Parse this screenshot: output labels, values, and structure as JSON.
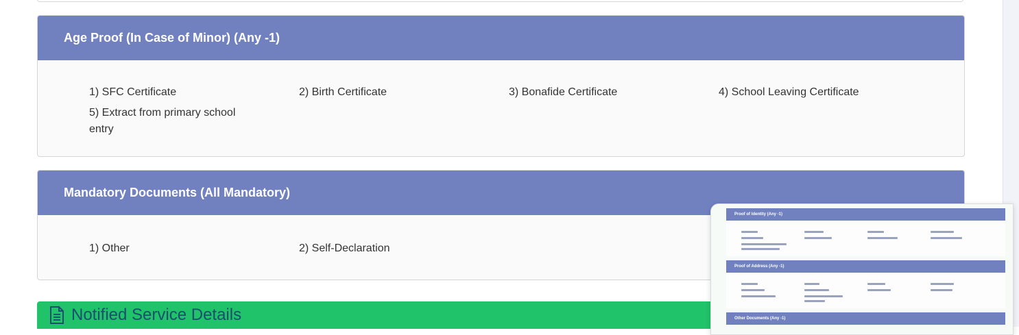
{
  "age_proof": {
    "title": "Age Proof (In Case of Minor) (Any -1)",
    "items": [
      "1) SFC Certificate",
      "2) Birth Certificate",
      "3) Bonafide Certificate",
      "4) School Leaving Certificate",
      "5) Extract from primary school entry"
    ]
  },
  "mandatory": {
    "title": "Mandatory Documents (All Mandatory)",
    "items": [
      "1) Other",
      "2) Self-Declaration"
    ]
  },
  "notified": {
    "title": "Notified Service Details",
    "icon": "document-icon"
  },
  "preview": {
    "identity_title": "Proof of Identity (Any -1)",
    "address_title": "Proof of Address (Any -1)",
    "other_title": "Other Documents (Any -1)"
  }
}
